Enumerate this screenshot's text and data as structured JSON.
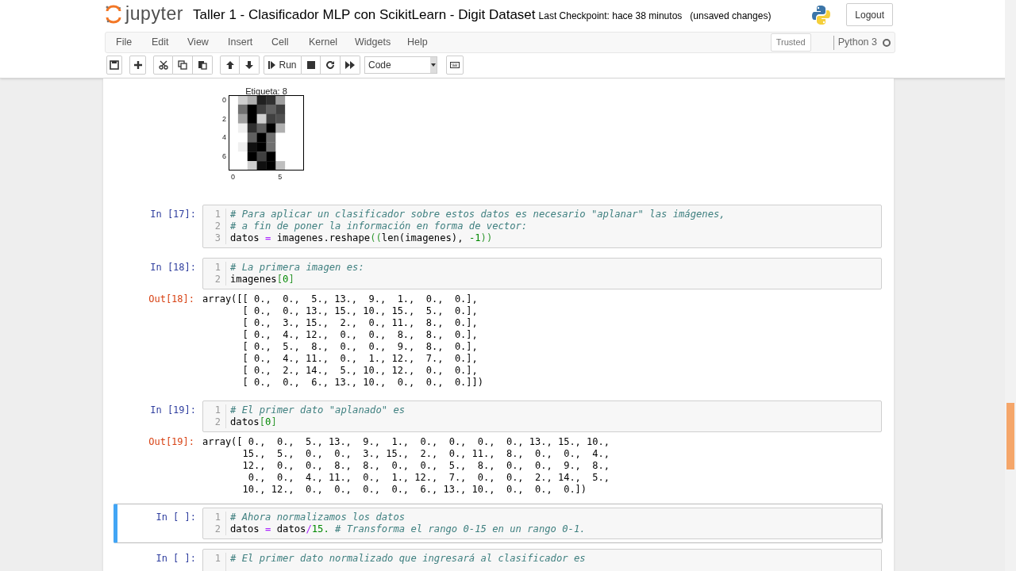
{
  "header": {
    "logo_text": "jupyter",
    "title": "Taller 1 - Clasificador MLP con ScikitLearn - Digit Dataset",
    "checkpoint": "Last Checkpoint: hace 38 minutos",
    "unsaved": "(unsaved changes)",
    "logout": "Logout"
  },
  "menu": [
    "File",
    "Edit",
    "View",
    "Insert",
    "Cell",
    "Kernel",
    "Widgets",
    "Help"
  ],
  "trusted": "Trusted",
  "kernel": {
    "name": "Python 3",
    "busy": false
  },
  "toolbar": {
    "run": "Run",
    "cell_type": "Code"
  },
  "plot": {
    "title": "Etiqueta: 8",
    "yticks": [
      "0",
      "2",
      "4",
      "6"
    ],
    "xticks": [
      "0",
      "5"
    ]
  },
  "cells": [
    {
      "prompt": "In [17]:",
      "selected": false,
      "lines": [
        {
          "number": "1",
          "tokens": [
            {
              "kind": "comment",
              "t": "# Para aplicar un clasificador sobre estos datos es necesario \"aplanar\" las imágenes,"
            }
          ]
        },
        {
          "number": "2",
          "tokens": [
            {
              "kind": "comment",
              "t": "# a fin de poner la información en forma de vector:"
            }
          ]
        },
        {
          "number": "3",
          "tokens": [
            {
              "kind": "name",
              "t": "datos "
            },
            {
              "kind": "op",
              "t": "="
            },
            {
              "kind": "name",
              "t": " imagenes.reshape"
            },
            {
              "kind": "bracket",
              "t": "(("
            },
            {
              "kind": "name",
              "t": "len(imagenes), "
            },
            {
              "kind": "number",
              "t": "-1"
            },
            {
              "kind": "bracket",
              "t": "))"
            }
          ]
        }
      ]
    },
    {
      "prompt": "In [18]:",
      "selected": false,
      "lines": [
        {
          "number": "1",
          "tokens": [
            {
              "kind": "comment",
              "t": "# La primera imagen es:"
            }
          ]
        },
        {
          "number": "2",
          "tokens": [
            {
              "kind": "name",
              "t": "imagenes"
            },
            {
              "kind": "bracket",
              "t": "["
            },
            {
              "kind": "number",
              "t": "0"
            },
            {
              "kind": "bracket",
              "t": "]"
            }
          ]
        }
      ],
      "out_prompt": "Out[18]:",
      "output": [
        "array([[ 0.,  0.,  5., 13.,  9.,  1.,  0.,  0.],",
        "       [ 0.,  0., 13., 15., 10., 15.,  5.,  0.],",
        "       [ 0.,  3., 15.,  2.,  0., 11.,  8.,  0.],",
        "       [ 0.,  4., 12.,  0.,  0.,  8.,  8.,  0.],",
        "       [ 0.,  5.,  8.,  0.,  0.,  9.,  8.,  0.],",
        "       [ 0.,  4., 11.,  0.,  1., 12.,  7.,  0.],",
        "       [ 0.,  2., 14.,  5., 10., 12.,  0.,  0.],",
        "       [ 0.,  0.,  6., 13., 10.,  0.,  0.,  0.]])"
      ]
    },
    {
      "prompt": "In [19]:",
      "selected": false,
      "lines": [
        {
          "number": "1",
          "tokens": [
            {
              "kind": "comment",
              "t": "# El primer dato \"aplanado\" es"
            }
          ]
        },
        {
          "number": "2",
          "tokens": [
            {
              "kind": "name",
              "t": "datos"
            },
            {
              "kind": "bracket",
              "t": "["
            },
            {
              "kind": "number",
              "t": "0"
            },
            {
              "kind": "bracket",
              "t": "]"
            }
          ]
        }
      ],
      "out_prompt": "Out[19]:",
      "output": [
        "array([ 0.,  0.,  5., 13.,  9.,  1.,  0.,  0.,  0.,  0., 13., 15., 10.,",
        "       15.,  5.,  0.,  0.,  3., 15.,  2.,  0., 11.,  8.,  0.,  0.,  4.,",
        "       12.,  0.,  0.,  8.,  8.,  0.,  0.,  5.,  8.,  0.,  0.,  9.,  8.,",
        "        0.,  0.,  4., 11.,  0.,  1., 12.,  7.,  0.,  0.,  2., 14.,  5.,",
        "       10., 12.,  0.,  0.,  0.,  0.,  6., 13., 10.,  0.,  0.,  0.])"
      ]
    },
    {
      "prompt": "In [ ]:",
      "selected": true,
      "lines": [
        {
          "number": "1",
          "tokens": [
            {
              "kind": "comment",
              "t": "# Ahora normalizamos los datos"
            }
          ]
        },
        {
          "number": "2",
          "tokens": [
            {
              "kind": "name",
              "t": "datos "
            },
            {
              "kind": "op",
              "t": "="
            },
            {
              "kind": "name",
              "t": " datos"
            },
            {
              "kind": "op",
              "t": "/"
            },
            {
              "kind": "number",
              "t": "15."
            },
            {
              "kind": "comment",
              "t": " # Transforma el rango 0-15 en un rango 0-1."
            }
          ]
        }
      ]
    },
    {
      "prompt": "In [ ]:",
      "selected": false,
      "lines": [
        {
          "number": "1",
          "tokens": [
            {
              "kind": "comment",
              "t": "# El primer dato normalizado que ingresará al clasificador es"
            }
          ]
        }
      ]
    }
  ]
}
